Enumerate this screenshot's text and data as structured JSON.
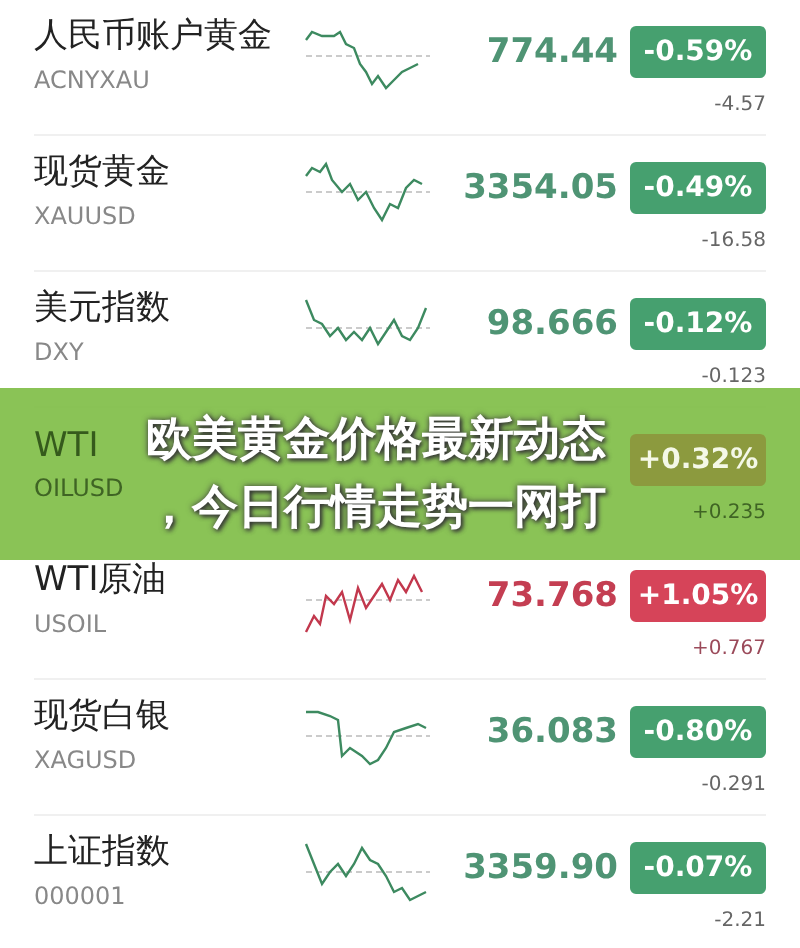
{
  "quotes": [
    {
      "name": "人民币账户黄金",
      "code": "ACNYXAU",
      "price": "774.44",
      "change_pct": "-0.59%",
      "change": "-4.57",
      "rising": false,
      "covered": false
    },
    {
      "name": "现货黄金",
      "code": "XAUUSD",
      "price": "3354.05",
      "change_pct": "-0.49%",
      "change": "-16.58",
      "rising": false,
      "covered": false
    },
    {
      "name": "美元指数",
      "code": "DXY",
      "price": "98.666",
      "change_pct": "-0.12%",
      "change": "-0.123",
      "rising": false,
      "covered": false
    },
    {
      "name": "WTI",
      "code": "OILUSD",
      "change_pct": "+0.32%",
      "change": "+0.235",
      "rising": true,
      "covered": true
    },
    {
      "name": "WTI原油",
      "code": "USOIL",
      "price": "73.768",
      "change_pct": "+1.05%",
      "change": "+0.767",
      "rising": true,
      "covered": false
    },
    {
      "name": "现货白银",
      "code": "XAGUSD",
      "price": "36.083",
      "change_pct": "-0.80%",
      "change": "-0.291",
      "rising": false,
      "covered": false
    },
    {
      "name": "上证指数",
      "code": "000001",
      "price": "3359.90",
      "change_pct": "-0.07%",
      "change": "-2.21",
      "rising": false,
      "covered": false
    }
  ],
  "banner": {
    "lines": [
      "欧美黄金价格最新动态",
      "，今日行情走势一网打"
    ]
  }
}
